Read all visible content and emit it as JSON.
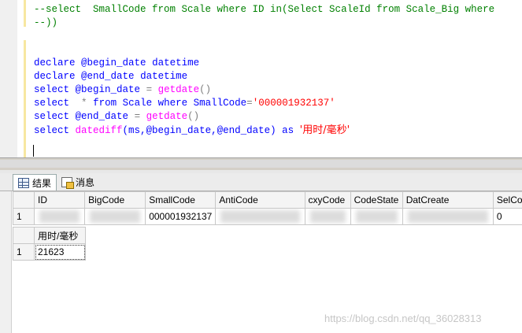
{
  "editor": {
    "line1": "--select  SmallCode from Scale where ID in(Select ScaleId from Scale_Big where",
    "line2": "--))",
    "l4_kw": "declare",
    "l4_var": "@begin_date",
    "l4_type": "datetime",
    "l5_kw": "declare",
    "l5_var": "@end_date",
    "l5_type": "datetime",
    "l6_kw": "select",
    "l6_var": "@begin_date",
    "l6_eq": "=",
    "l6_fn": "getdate",
    "l6_paren": "()",
    "l7_kw": "select",
    "l7_star": "*",
    "l7_from": "from",
    "l7_tbl": "Scale",
    "l7_where": "where",
    "l7_col": "SmallCode",
    "l7_eq": "=",
    "l7_str": "'000001932137'",
    "l8_kw": "select",
    "l8_var": "@end_date",
    "l8_eq": "=",
    "l8_fn": "getdate",
    "l8_paren": "()",
    "l9_kw": "select",
    "l9_fn": "datediff",
    "l9_args": "(ms,@begin_date,@end_date)",
    "l9_as": "as",
    "l9_str": "'用时/毫秒'"
  },
  "tabs": [
    {
      "label": "结果",
      "icon": "grid-icon"
    },
    {
      "label": "消息",
      "icon": "message-icon"
    }
  ],
  "grid1": {
    "columns": [
      "ID",
      "BigCode",
      "SmallCode",
      "AntiCode",
      "cxyCode",
      "CodeState",
      "DatCreate",
      "SelCou"
    ],
    "row": [
      "1",
      "",
      "",
      "000001932137",
      "",
      "",
      "",
      "",
      "0"
    ]
  },
  "grid2": {
    "columns": [
      "用时/毫秒"
    ],
    "row_number": "1",
    "value": "21623"
  },
  "watermark": "https://blog.csdn.net/qq_36028313"
}
